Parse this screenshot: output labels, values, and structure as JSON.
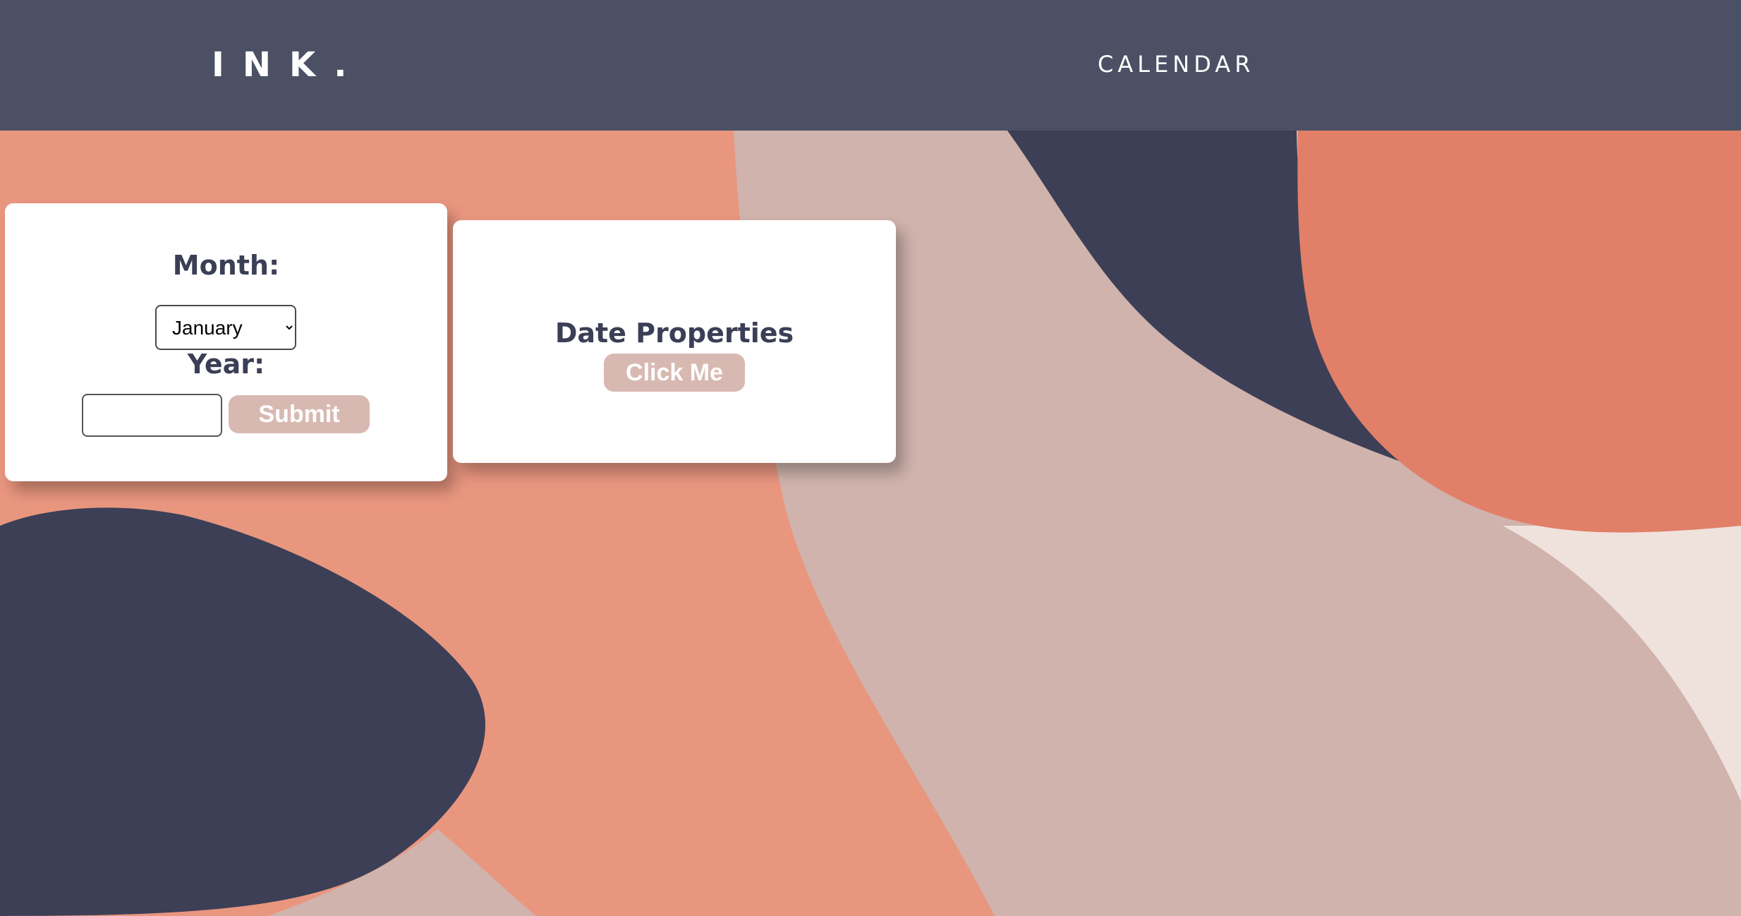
{
  "header": {
    "logo": "INK.",
    "nav_link": "CALENDAR"
  },
  "date_form": {
    "month_label": "Month:",
    "month_selected": "January",
    "year_label": "Year:",
    "year_value": "",
    "submit_label": "Submit"
  },
  "properties_card": {
    "title": "Date Properties",
    "button_label": "Click Me"
  },
  "colors": {
    "header_bg": "#4b5064",
    "card_bg": "#ffffff",
    "label_text": "#3b3f56",
    "button_bg": "#d8b9b2",
    "button_text": "#ffffff",
    "bg_navy": "#3c3f56",
    "bg_coral": "#e9967f",
    "bg_dusty_pink": "#cfb3ac",
    "bg_light": "#efe2dc"
  }
}
